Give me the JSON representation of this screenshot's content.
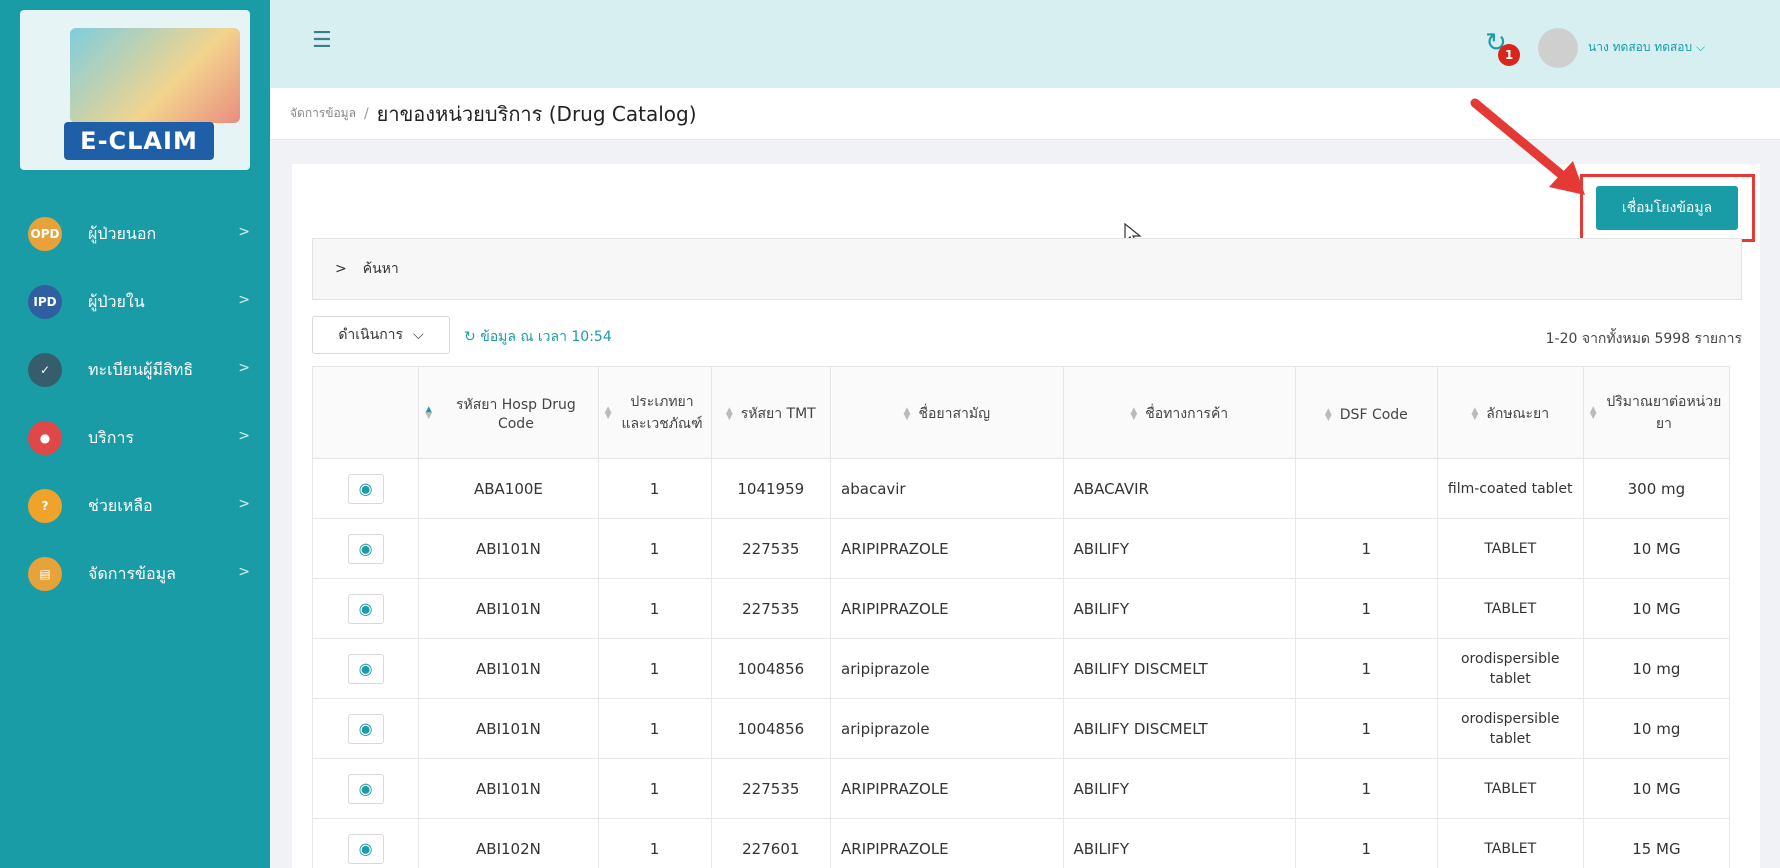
{
  "brand": {
    "logo_text": "E-CLAIM"
  },
  "sidebar": {
    "items": [
      {
        "label": "ผู้ป่วยนอก",
        "icon": "opd-icon",
        "icon_text": "OPD",
        "icon_color": "#e8a23a"
      },
      {
        "label": "ผู้ป่วยใน",
        "icon": "ipd-icon",
        "icon_text": "IPD",
        "icon_color": "#2f5fa0"
      },
      {
        "label": "ทะเบียนผู้มีสิทธิ",
        "icon": "registry-icon",
        "icon_text": "✓",
        "icon_color": "#355d6b"
      },
      {
        "label": "บริการ",
        "icon": "location-pin-icon",
        "icon_text": "●",
        "icon_color": "#e04848"
      },
      {
        "label": "ช่วยเหลือ",
        "icon": "help-person-icon",
        "icon_text": "?",
        "icon_color": "#f0a32a"
      },
      {
        "label": "จัดการข้อมูล",
        "icon": "data-manage-icon",
        "icon_text": "▤",
        "icon_color": "#e8a23a"
      }
    ]
  },
  "header": {
    "notification_count": "1",
    "user_name": "นาง ทดสอบ ทดสอบ"
  },
  "breadcrumb": {
    "parent": "จัดการข้อมูล",
    "separator": "/",
    "title": "ยาของหน่วยบริการ (Drug Catalog)"
  },
  "actions": {
    "connect_label": "เชื่อมโยงข้อมูล"
  },
  "search": {
    "label": "ค้นหา"
  },
  "toolbar": {
    "action_label": "ดำเนินการ",
    "refresh_label": "ข้อมูล ณ เวลา 10:54",
    "count_text": "1-20 จากทั้งหมด 5998 รายการ"
  },
  "table": {
    "headers": [
      "",
      "รหัสยา Hosp Drug Code",
      "ประเภทยาและเวชภัณฑ์",
      "รหัสยา TMT",
      "ชื่อยาสามัญ",
      "ชื่อทางการค้า",
      "DSF Code",
      "ลักษณะยา",
      "ปริมาณยาต่อหน่วยยา"
    ],
    "rows": [
      {
        "code": "ABA100E",
        "type": "1",
        "tmt": "1041959",
        "generic": "abacavir",
        "trade": "ABACAVIR",
        "dsf": "",
        "form": "film-coated tablet",
        "dose": "300 mg"
      },
      {
        "code": "ABI101N",
        "type": "1",
        "tmt": "227535",
        "generic": "ARIPIPRAZOLE",
        "trade": "ABILIFY",
        "dsf": "1",
        "form": "TABLET",
        "dose": "10 MG"
      },
      {
        "code": "ABI101N",
        "type": "1",
        "tmt": "227535",
        "generic": "ARIPIPRAZOLE",
        "trade": "ABILIFY",
        "dsf": "1",
        "form": "TABLET",
        "dose": "10 MG"
      },
      {
        "code": "ABI101N",
        "type": "1",
        "tmt": "1004856",
        "generic": "aripiprazole",
        "trade": "ABILIFY DISCMELT",
        "dsf": "1",
        "form": "orodispersible tablet",
        "dose": "10 mg"
      },
      {
        "code": "ABI101N",
        "type": "1",
        "tmt": "1004856",
        "generic": "aripiprazole",
        "trade": "ABILIFY DISCMELT",
        "dsf": "1",
        "form": "orodispersible tablet",
        "dose": "10 mg"
      },
      {
        "code": "ABI101N",
        "type": "1",
        "tmt": "227535",
        "generic": "ARIPIPRAZOLE",
        "trade": "ABILIFY",
        "dsf": "1",
        "form": "TABLET",
        "dose": "10 MG"
      },
      {
        "code": "ABI102N",
        "type": "1",
        "tmt": "227601",
        "generic": "ARIPIPRAZOLE",
        "trade": "ABILIFY",
        "dsf": "1",
        "form": "TABLET",
        "dose": "15 MG"
      }
    ]
  },
  "colors": {
    "accent": "#1a9ca6",
    "highlight": "#e53935",
    "badge": "#d9261c"
  }
}
